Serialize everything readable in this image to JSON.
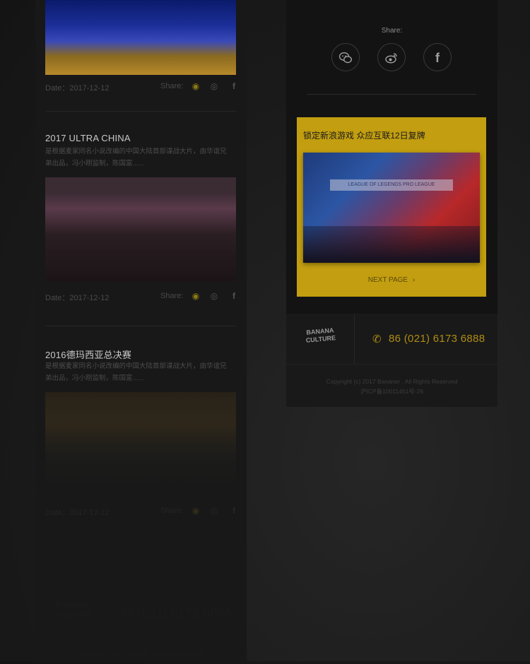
{
  "left_column": {
    "posts": [
      {
        "image_alt": "LEGENDS stage",
        "date": "Date：2017-12-12",
        "share_label": "Share:"
      },
      {
        "title": "2017 ULTRA CHINA",
        "desc": "是根据麦家同名小说改编的中国大陆首部谍战大片，由华谊兄弟出品，冯小刚监制，陈国富......",
        "image_alt": "Ultra festival stage",
        "date": "Date：2017-12-12",
        "share_label": "Share:"
      },
      {
        "title": "2016德玛西亚总决赛",
        "desc": "是根据麦家同名小说改编的中国大陆首部谍战大片，由华谊兄弟出品，冯小刚监制，陈国富......",
        "image_alt": "Demacia finals stage",
        "date": "Date：2017-12-12",
        "share_label": "Share:"
      }
    ],
    "footer_logo": "BANANA CULTURE",
    "footer_phone": "86 (021) 6173 6888",
    "copyright": "Copyright (c) 2017 Bananer . All Rights Reserved"
  },
  "right_column": {
    "share_label": "Share:",
    "share_icons": [
      "wechat-icon",
      "weibo-icon",
      "facebook-icon"
    ],
    "promo": {
      "title": "锁定新浪游戏 众应互联12日复牌",
      "image_caption": "LEAGUE OF LEGENDS PRO LEAGUE",
      "next_label": "NEXT PAGE",
      "next_arrow": "›"
    },
    "footer": {
      "logo": "BANANA CULTURE",
      "phone": "86 (021) 6173 6888",
      "copyright_line1": "Copyright (c) 2017 Bananer . All Rights Reserved",
      "copyright_line2": "沪ICP备10011451号-26"
    }
  },
  "colors": {
    "accent": "#c29e10",
    "phone": "#b08d12",
    "background": "#1a1a1a"
  }
}
